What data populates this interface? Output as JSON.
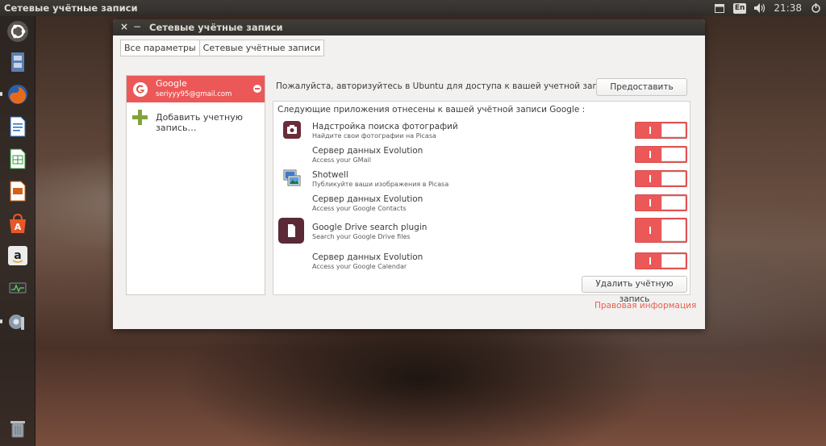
{
  "top_panel": {
    "title": "Сетевые учётные записи",
    "keyboard_layout": "En",
    "clock": "21:38",
    "tray_icons": [
      "window-icon",
      "keyboard-layout-icon",
      "volume-icon",
      "power-gear-icon"
    ]
  },
  "launcher": {
    "items": [
      "ubuntu-dash-icon",
      "files-icon",
      "firefox-icon",
      "libreoffice-writer-icon",
      "libreoffice-calc-icon",
      "libreoffice-impress-icon",
      "ubuntu-software-center-icon",
      "amazon-icon",
      "system-monitor-icon",
      "settings-icon",
      "trash-icon"
    ]
  },
  "window": {
    "title": "Сетевые учётные записи",
    "close_glyph": "×",
    "minimize_glyph": "−",
    "breadcrumb": [
      "Все параметры",
      "Сетевые учётные записи"
    ]
  },
  "sidebar": {
    "account": {
      "name": "Google",
      "email": "seriyyy95@gmail.com"
    },
    "add_label": "Добавить учетную запись…"
  },
  "main": {
    "auth_text": "Пожалуйста, авторизуйтесь в Ubuntu для доступа к вашей учетной записи Google :",
    "grant_button": "Предоставить доступ",
    "apps_header": "Следующие приложения отнесены к вашей учётной записи Google :",
    "apps": [
      {
        "name": "Надстройка поиска фотографий",
        "desc": "Найдите свои фотографии на Picasa",
        "icon": "camera-icon",
        "enabled": true
      },
      {
        "name": "Сервер данных Evolution",
        "desc": "Access your GMail",
        "icon": "",
        "enabled": true
      },
      {
        "name": "Shotwell",
        "desc": "Публикуйте ваши изображения в Picasa",
        "icon": "shotwell-icon",
        "enabled": true
      },
      {
        "name": "Сервер данных Evolution",
        "desc": "Access your Google Contacts",
        "icon": "",
        "enabled": true
      },
      {
        "name": "Google Drive search plugin",
        "desc": "Search your Google Drive files",
        "icon": "google-drive-plugin-icon",
        "enabled": true
      },
      {
        "name": "Сервер данных Evolution",
        "desc": "Access your Google Calendar",
        "icon": "",
        "enabled": true
      }
    ],
    "remove_button": "Удалить учётную запись",
    "legal_link": "Правовая информация"
  },
  "colors": {
    "accent": "#ec5858",
    "link": "#e95e4b",
    "panel": "#33312e",
    "window_bg": "#f2f1f0"
  }
}
